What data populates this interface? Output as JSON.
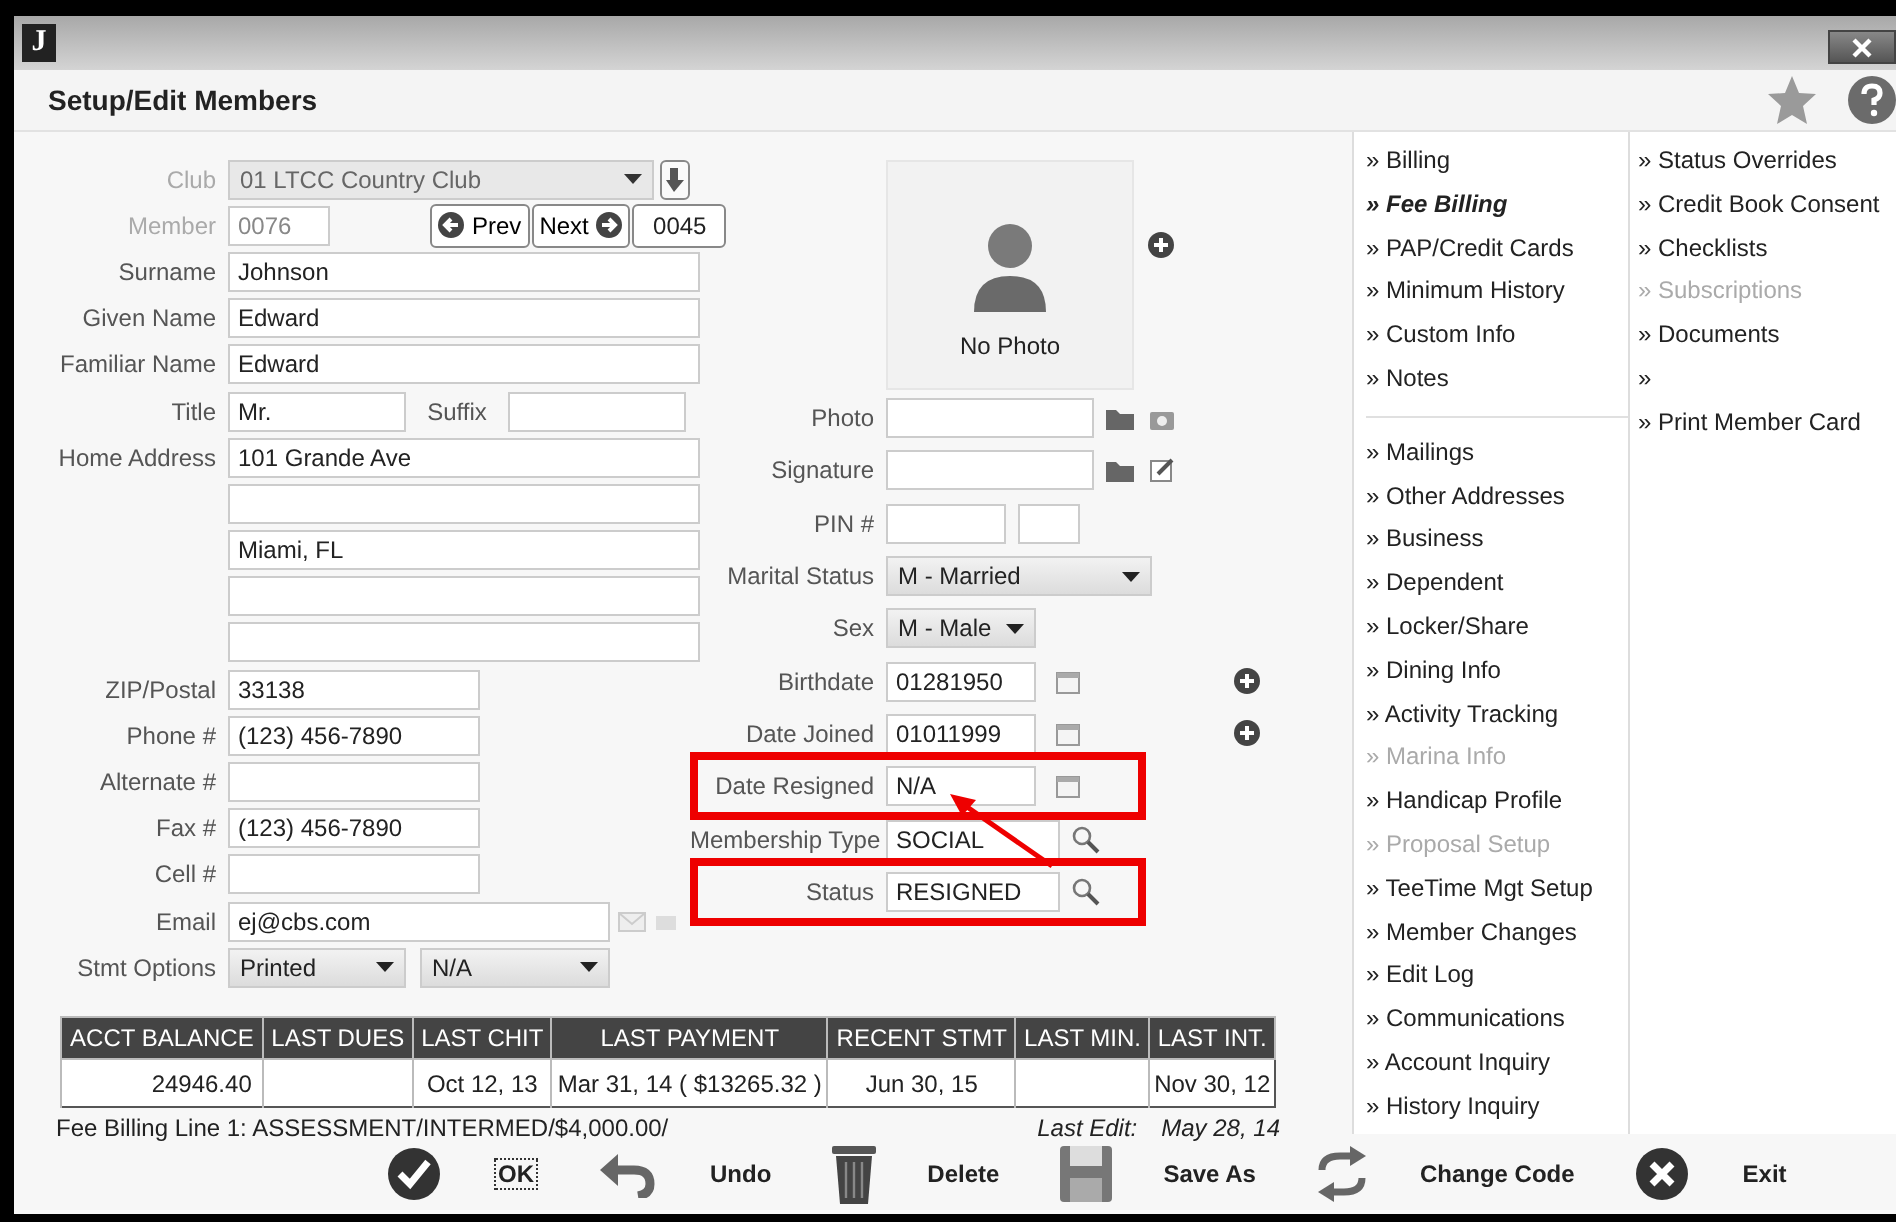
{
  "window": {
    "logo": "J"
  },
  "header": {
    "title": "Setup/Edit Members"
  },
  "club": {
    "label": "Club",
    "value": "01 LTCC Country Club",
    "disabled": true
  },
  "member": {
    "label": "Member",
    "value": "0076",
    "disabled": true,
    "prev": "Prev",
    "next": "Next",
    "next_number": "0045"
  },
  "left_rows": [
    {
      "kind": "wide",
      "label": "Surname",
      "value": "Johnson"
    },
    {
      "kind": "wide",
      "label": "Given Name",
      "value": "Edward"
    },
    {
      "kind": "wide",
      "label": "Familiar Name",
      "value": "Edward"
    },
    {
      "kind": "pair",
      "label": "Title",
      "value": "Mr.",
      "label2": "Suffix"
    },
    {
      "kind": "wide",
      "label": "Home Address",
      "value": "101 Grande Ave"
    },
    {
      "kind": "wide"
    },
    {
      "kind": "wide",
      "value": "Miami, FL"
    },
    {
      "kind": "wide"
    },
    {
      "kind": "wide"
    },
    {
      "kind": "narrow",
      "label": "ZIP/Postal",
      "value": "33138"
    },
    {
      "kind": "narrow",
      "label": "Phone #",
      "value": "(123) 456-7890"
    },
    {
      "kind": "narrow",
      "label": "Alternate #"
    },
    {
      "kind": "narrow",
      "label": "Fax #",
      "value": "(123) 456-7890"
    },
    {
      "kind": "narrow",
      "label": "Cell #"
    },
    {
      "kind": "email",
      "label": "Email",
      "value": "ej@cbs.com"
    },
    {
      "kind": "selects",
      "label": "Stmt Options",
      "value": "Printed",
      "value2": "N/A"
    }
  ],
  "photo": {
    "caption": "No Photo",
    "add_button": true
  },
  "middle_rows": [
    {
      "kind": "file",
      "label": "Photo",
      "highlighted": false,
      "add_button": false
    },
    {
      "kind": "file",
      "label": "Signature",
      "highlighted": false,
      "add_button": false
    },
    {
      "kind": "pin",
      "label": "PIN #",
      "highlighted": false,
      "add_button": false
    },
    {
      "kind": "select",
      "label": "Marital Status",
      "value": "M - Married",
      "highlighted": false,
      "add_button": false
    },
    {
      "kind": "short_select",
      "label": "Sex",
      "value": "M - Male",
      "highlighted": false,
      "add_button": false
    },
    {
      "kind": "date",
      "label": "Birthdate",
      "value": "01281950",
      "highlighted": false,
      "add_button": true
    },
    {
      "kind": "date",
      "label": "Date Joined",
      "value": "01011999",
      "highlighted": false,
      "add_button": true
    },
    {
      "kind": "date",
      "label": "Date Resigned",
      "value": "N/A",
      "highlighted": true,
      "add_button": false
    },
    {
      "kind": "lookup",
      "label": "Membership Type",
      "value": "SOCIAL",
      "highlighted": false,
      "add_button": false
    },
    {
      "kind": "lookup",
      "label": "Status",
      "value": "RESIGNED",
      "highlighted": true,
      "add_button": false
    }
  ],
  "table": {
    "columns": [
      "ACCT BALANCE",
      "LAST DUES",
      "LAST CHIT",
      "LAST PAYMENT",
      "RECENT STMT",
      "LAST MIN.",
      "LAST INT."
    ],
    "rows": [
      [
        "24946.40",
        "",
        "Oct 12, 13",
        "Mar 31, 14   ( $13265.32 )",
        "Jun 30, 15",
        "",
        "Nov 30, 12"
      ]
    ]
  },
  "footer": {
    "billing_line": "Fee Billing Line 1: ASSESSMENT/INTERMED/$4,000.00/",
    "last_edit_label": "Last Edit:",
    "last_edit": "May 28, 14"
  },
  "link_groups": [
    [
      {
        "label": "» Billing",
        "emphasis": false,
        "disabled": false
      },
      {
        "label": "» Fee Billing",
        "emphasis": true,
        "disabled": false
      },
      {
        "label": "» PAP/Credit Cards",
        "emphasis": false,
        "disabled": false
      },
      {
        "label": "» Minimum History",
        "emphasis": false,
        "disabled": false
      },
      {
        "label": "» Custom Info",
        "emphasis": false,
        "disabled": false
      },
      {
        "label": "» Notes",
        "emphasis": false,
        "disabled": false
      }
    ],
    [
      {
        "label": "» Mailings",
        "emphasis": false,
        "disabled": false
      },
      {
        "label": "» Other Addresses",
        "emphasis": false,
        "disabled": false
      },
      {
        "label": "» Business",
        "emphasis": false,
        "disabled": false
      },
      {
        "label": "» Dependent",
        "emphasis": false,
        "disabled": false
      },
      {
        "label": "» Locker/Share",
        "emphasis": false,
        "disabled": false
      },
      {
        "label": "» Dining Info",
        "emphasis": false,
        "disabled": false
      },
      {
        "label": "» Activity Tracking",
        "emphasis": false,
        "disabled": false
      },
      {
        "label": "» Marina Info",
        "emphasis": false,
        "disabled": true
      },
      {
        "label": "» Handicap Profile",
        "emphasis": false,
        "disabled": false
      },
      {
        "label": "» Proposal Setup",
        "emphasis": false,
        "disabled": true
      },
      {
        "label": "» TeeTime Mgt Setup",
        "emphasis": false,
        "disabled": false
      },
      {
        "label": "» Member Changes",
        "emphasis": false,
        "disabled": false
      },
      {
        "label": "» Edit Log",
        "emphasis": false,
        "disabled": false
      },
      {
        "label": "» Communications",
        "emphasis": false,
        "disabled": false
      },
      {
        "label": "» Account Inquiry",
        "emphasis": false,
        "disabled": false
      },
      {
        "label": "» History Inquiry",
        "emphasis": false,
        "disabled": false
      }
    ]
  ],
  "links_right": [
    {
      "label": "» Status Overrides",
      "disabled": false
    },
    {
      "label": "» Credit Book Consent",
      "disabled": false
    },
    {
      "label": "» Checklists",
      "disabled": false
    },
    {
      "label": "» Subscriptions",
      "disabled": true
    },
    {
      "label": "» Documents",
      "disabled": false
    },
    {
      "label": "»",
      "disabled": false
    },
    {
      "label": "» Print Member Card",
      "disabled": false
    }
  ],
  "toolbar": [
    {
      "kind": "ok",
      "label": "OK"
    },
    {
      "kind": "undo",
      "label": "Undo"
    },
    {
      "kind": "delete",
      "label": "Delete"
    },
    {
      "kind": "save",
      "label": "Save As"
    },
    {
      "kind": "change",
      "label": "Change Code"
    },
    {
      "kind": "exit",
      "label": "Exit"
    }
  ]
}
